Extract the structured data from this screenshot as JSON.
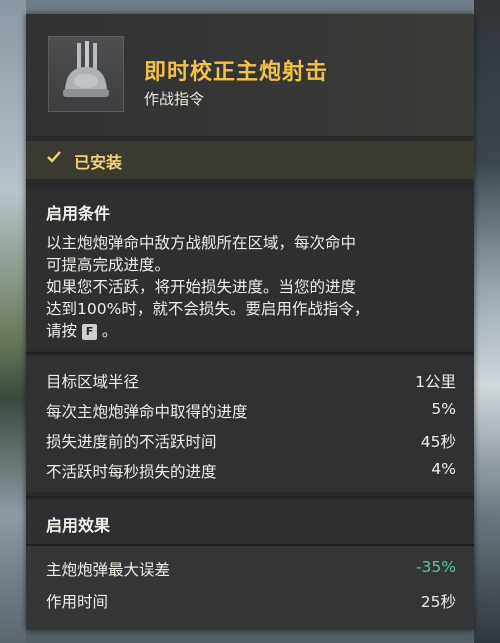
{
  "module": {
    "title": "即时校正主炮射击",
    "type": "作战指令",
    "icon": "main-battery-turret-icon"
  },
  "status": {
    "label": "已安装",
    "icon": "checkmark-icon"
  },
  "conditions": {
    "title": "启用条件",
    "line1": "以主炮炮弹命中敌方战舰所在区域，每次命中",
    "line2": "可提高完成进度。",
    "line3": "如果您不活跃，将开始损失进度。当您的进度",
    "line4": "达到100%时，就不会损失。要启用作战指令，",
    "line5_prefix": "请按",
    "key": "F",
    "line5_suffix": "。"
  },
  "stats": [
    {
      "label": "目标区域半径",
      "value": "1公里"
    },
    {
      "label": "每次主炮炮弹命中取得的进度",
      "value": "5%"
    },
    {
      "label": "损失进度前的不活跃时间",
      "value": "45秒"
    },
    {
      "label": "不活跃时每秒损失的进度",
      "value": "4%"
    }
  ],
  "effects": {
    "title": "启用效果",
    "rows": [
      {
        "label": "主炮炮弹最大误差",
        "value": "-35%"
      },
      {
        "label": "作用时间",
        "value": "25秒"
      }
    ]
  },
  "colors": {
    "title_gold": "#f2c14a",
    "status_gold": "#f2d277",
    "positive_green": "#5fc89a",
    "panel_bg": "#2a2b2d"
  }
}
